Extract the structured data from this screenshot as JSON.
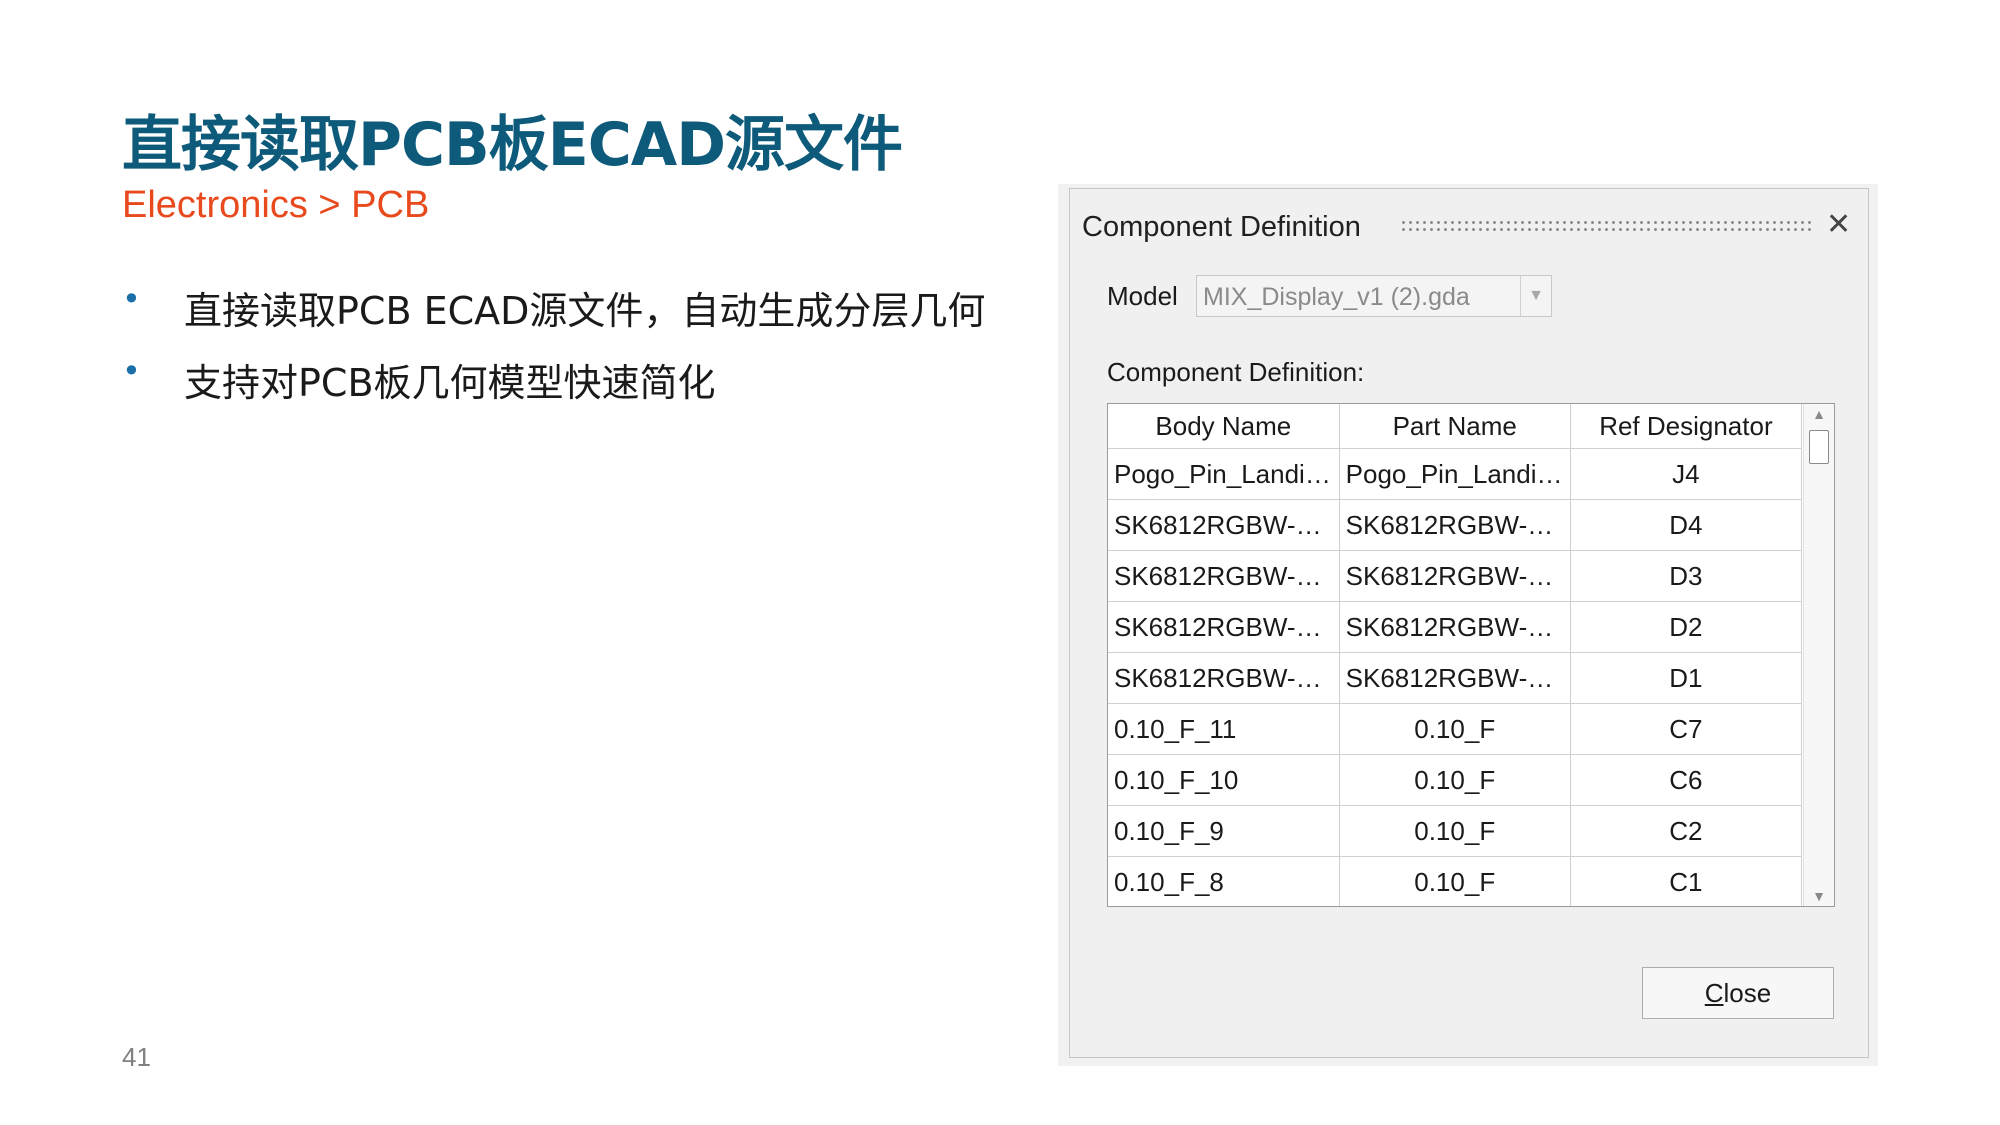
{
  "slide": {
    "title": "直接读取PCB板ECAD源文件",
    "subtitle": "Electronics > PCB",
    "bullet_symbol": "•",
    "bullets": [
      "直接读取PCB ECAD源文件，自动生成分层几何",
      "支持对PCB板几何模型快速简化"
    ],
    "page_number": "41",
    "colors": {
      "title": "#0e5a7a",
      "subtitle": "#e8491d",
      "bullet": "#1a6fa8"
    }
  },
  "dialog": {
    "title": "Component Definition",
    "close_icon": "close-icon",
    "model_label": "Model",
    "model_value": "MIX_Display_v1 (2).gda",
    "table_label": "Component Definition:",
    "columns": [
      "Body Name",
      "Part Name",
      "Ref Designator"
    ],
    "rows": [
      [
        "Pogo_Pin_Landi…",
        "Pogo_Pin_Landi…",
        "J4"
      ],
      [
        "SK6812RGBW-…",
        "SK6812RGBW-…",
        "D4"
      ],
      [
        "SK6812RGBW-…",
        "SK6812RGBW-…",
        "D3"
      ],
      [
        "SK6812RGBW-…",
        "SK6812RGBW-…",
        "D2"
      ],
      [
        "SK6812RGBW-…",
        "SK6812RGBW-…",
        "D1"
      ],
      [
        "0.10_F_11",
        "0.10_F",
        "C7"
      ],
      [
        "0.10_F_10",
        "0.10_F",
        "C6"
      ],
      [
        "0.10_F_9",
        "0.10_F",
        "C2"
      ],
      [
        "0.10_F_8",
        "0.10_F",
        "C1"
      ]
    ],
    "close_button_mnemonic": "C",
    "close_button_rest": "lose"
  }
}
